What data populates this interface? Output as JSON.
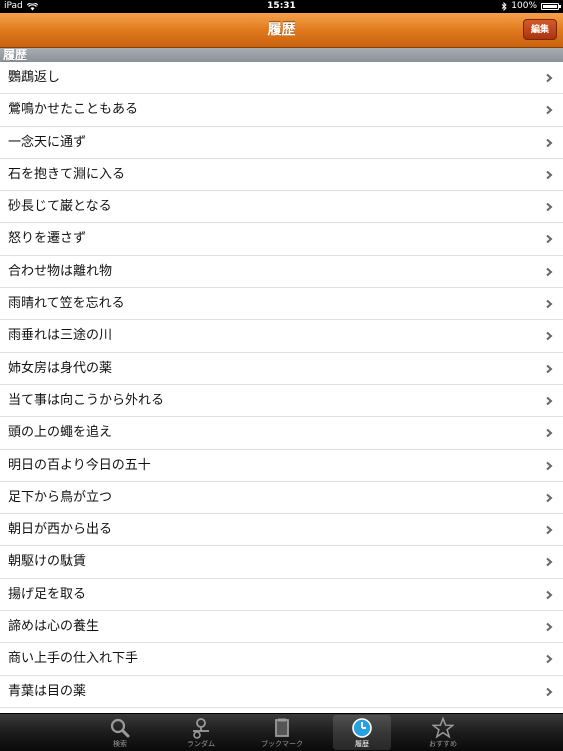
{
  "status": {
    "device": "iPad",
    "time": "15:31",
    "battery": "100%",
    "battery_level": 1.0
  },
  "nav": {
    "title": "履歴",
    "edit_label": "編集"
  },
  "section": {
    "header": "履歴"
  },
  "history": [
    "鸚鵡返し",
    "鶯鳴かせたこともある",
    "一念天に通ず",
    "石を抱きて淵に入る",
    "砂長じて巌となる",
    "怒りを遷さず",
    "合わせ物は離れ物",
    "雨晴れて笠を忘れる",
    "雨垂れは三途の川",
    "姉女房は身代の薬",
    "当て事は向こうから外れる",
    "頭の上の蠅を追え",
    "明日の百より今日の五十",
    "足下から鳥が立つ",
    "朝日が西から出る",
    "朝駆けの駄賃",
    "揚げ足を取る",
    "諦めは心の養生",
    "商い上手の仕入れ下手",
    "青葉は目の薬"
  ],
  "tabs": [
    {
      "label": "検索",
      "icon": "search-icon"
    },
    {
      "label": "ランダム",
      "icon": "random-icon"
    },
    {
      "label": "ブックマーク",
      "icon": "bookmark-icon"
    },
    {
      "label": "履歴",
      "icon": "clock-icon",
      "selected": true
    },
    {
      "label": "おすすめ",
      "icon": "star-icon"
    }
  ],
  "colors": {
    "accent": "#e07a1e",
    "edit": "#b8401a",
    "selected_tab": "#2aa0e0"
  }
}
